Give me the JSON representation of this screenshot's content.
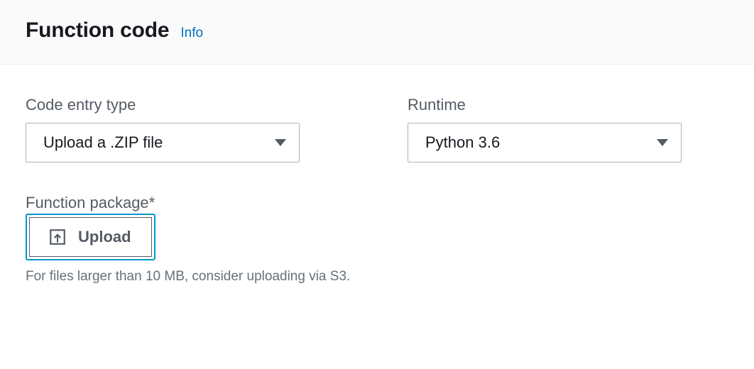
{
  "header": {
    "title": "Function code",
    "info_label": "Info"
  },
  "fields": {
    "code_entry": {
      "label": "Code entry type",
      "value": "Upload a .ZIP file"
    },
    "runtime": {
      "label": "Runtime",
      "value": "Python 3.6"
    },
    "function_package": {
      "label": "Function package*",
      "button_label": "Upload",
      "hint": "For files larger than 10 MB, consider uploading via S3."
    }
  }
}
